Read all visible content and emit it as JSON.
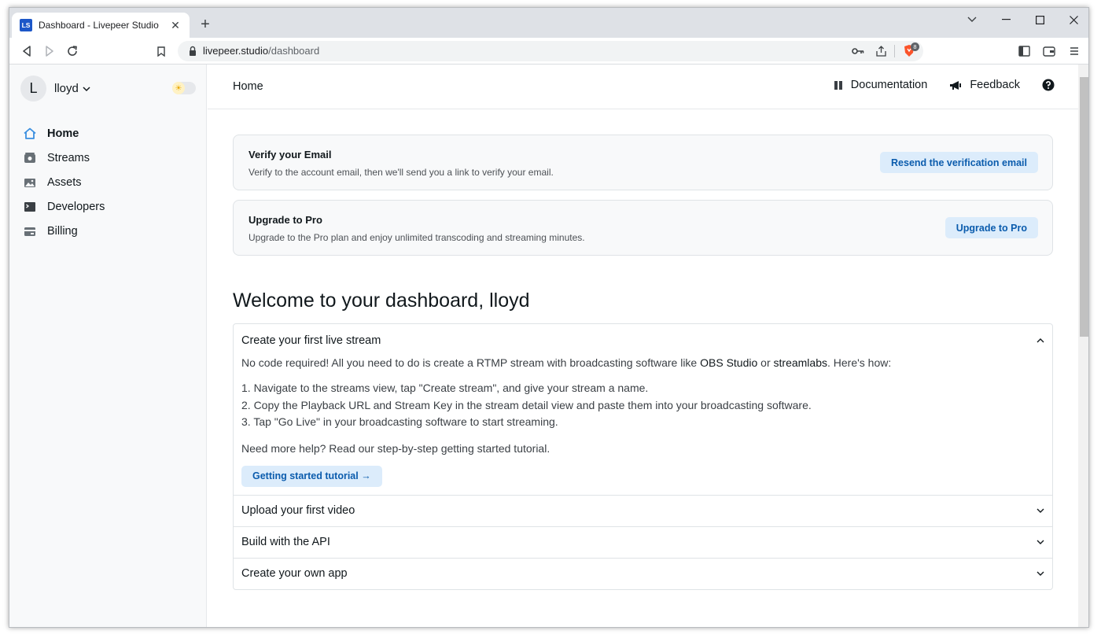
{
  "browser": {
    "tab_title": "Dashboard - Livepeer Studio",
    "favicon_text": "LS",
    "url_host": "livepeer.studio",
    "url_path": "/dashboard",
    "extension_badge": "8"
  },
  "sidebar": {
    "avatar_letter": "L",
    "username": "lloyd",
    "items": [
      {
        "label": "Home",
        "icon": "home-icon"
      },
      {
        "label": "Streams",
        "icon": "streams-icon"
      },
      {
        "label": "Assets",
        "icon": "assets-icon"
      },
      {
        "label": "Developers",
        "icon": "terminal-icon"
      },
      {
        "label": "Billing",
        "icon": "billing-icon"
      }
    ]
  },
  "header": {
    "breadcrumb": "Home",
    "documentation": "Documentation",
    "feedback": "Feedback"
  },
  "banners": {
    "verify": {
      "title": "Verify your Email",
      "text": "Verify to the account email, then we'll send you a link to verify your email.",
      "button": "Resend the verification email"
    },
    "upgrade": {
      "title": "Upgrade to Pro",
      "text": "Upgrade to the Pro plan and enjoy unlimited transcoding and streaming minutes.",
      "button": "Upgrade to Pro"
    }
  },
  "welcome": "Welcome to your dashboard, lloyd",
  "accordion": {
    "items": [
      {
        "title": "Create your first live stream"
      },
      {
        "title": "Upload your first video"
      },
      {
        "title": "Build with the API"
      },
      {
        "title": "Create your own app"
      }
    ],
    "stream": {
      "intro_before": "No code required! All you need to do is create a RTMP stream with broadcasting software like ",
      "link_obs": "OBS Studio",
      "intro_or": " or ",
      "link_streamlabs": "streamlabs",
      "intro_after": ". Here's how:",
      "steps": [
        "1. Navigate to the streams view, tap \"Create stream\", and give your stream a name.",
        "2. Copy the Playback URL and Stream Key in the stream detail view and paste them into your broadcasting software.",
        "3. Tap \"Go Live\" in your broadcasting software to start streaming."
      ],
      "help": "Need more help? Read our step-by-step getting started tutorial.",
      "button": "Getting started tutorial →"
    }
  },
  "colors": {
    "accent": "#0b5cad",
    "button_bg": "#dcecfb",
    "sidebar_bg": "#f8f9fa"
  }
}
